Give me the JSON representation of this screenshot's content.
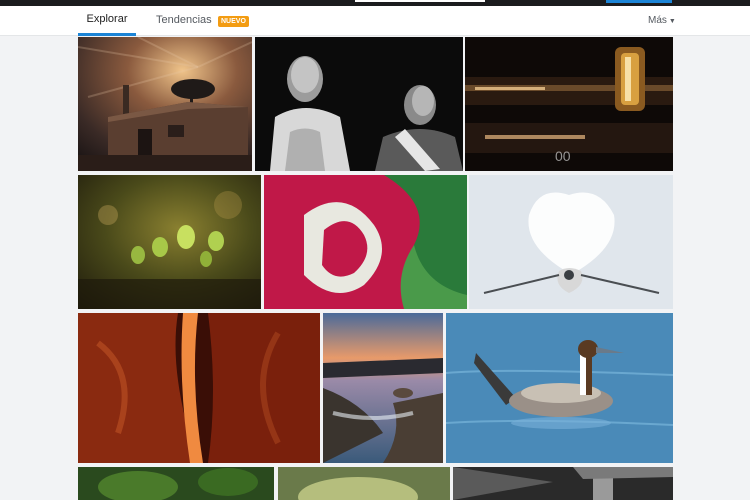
{
  "nav": {
    "tabs": [
      {
        "label": "Explorar",
        "active": true
      },
      {
        "label": "Tendencias",
        "active": false
      }
    ],
    "new_badge": "NUEVO",
    "more_label": "Más"
  },
  "colors": {
    "accent": "#1b84d6",
    "badge": "#f39c12",
    "topbar": "#1b1c1e"
  },
  "photos": [
    {
      "subject": "abandoned wooden shack at dusk"
    },
    {
      "subject": "black and white portrait of two men"
    },
    {
      "subject": "close-up of vintage radio with gold knob"
    },
    {
      "subject": "water droplets on green sprouts"
    },
    {
      "subject": "red and green fabric folds"
    },
    {
      "subject": "white tulle bundle tied with ribbon"
    },
    {
      "subject": "red sandstone slot canyon"
    },
    {
      "subject": "rocky seashore at sunset"
    },
    {
      "subject": "pintail duck swimming on blue water"
    },
    {
      "subject": "green foliage"
    },
    {
      "subject": "soft green light"
    },
    {
      "subject": "black and white interior"
    }
  ]
}
